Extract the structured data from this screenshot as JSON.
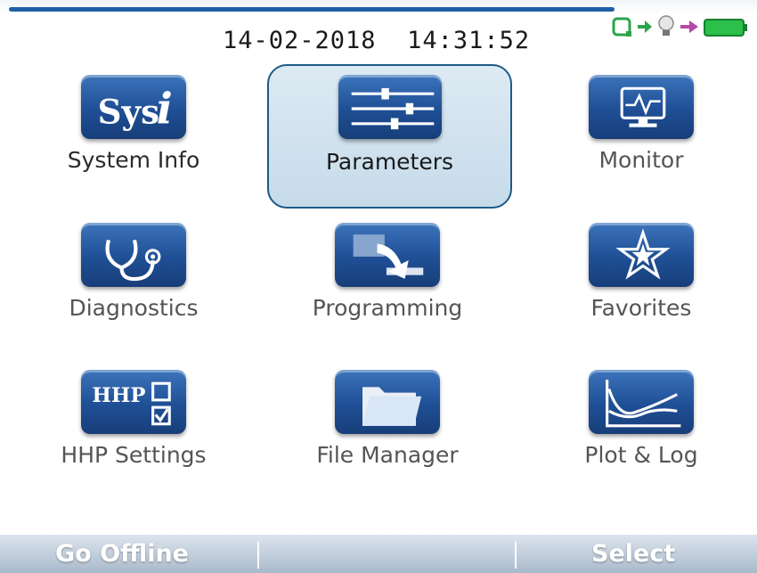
{
  "header": {
    "date": "14-02-2018",
    "time": "14:31:52"
  },
  "status_icons": [
    "connection-icon",
    "arrow-icon",
    "bulb-icon",
    "arrow-icon",
    "battery-icon"
  ],
  "colors": {
    "accent": "#1f5fa8",
    "selected_bg": "#cfe0ed",
    "icon_blue": "#2457a0",
    "softkey_bar": "#bccada"
  },
  "menu": {
    "selected": "Parameters",
    "items": [
      {
        "label": "System Info",
        "icon": "system-info-icon"
      },
      {
        "label": "Parameters",
        "icon": "parameters-sliders-icon"
      },
      {
        "label": "Monitor",
        "icon": "monitor-icon"
      },
      {
        "label": "Diagnostics",
        "icon": "stethoscope-icon"
      },
      {
        "label": "Programming",
        "icon": "programming-icon"
      },
      {
        "label": "Favorites",
        "icon": "favorites-star-icon"
      },
      {
        "label": "HHP Settings",
        "icon": "hhp-settings-icon"
      },
      {
        "label": "File Manager",
        "icon": "folder-icon"
      },
      {
        "label": "Plot & Log",
        "icon": "plot-icon"
      }
    ]
  },
  "softkeys": {
    "left": "Go Offline",
    "middle": "",
    "right": "Select"
  }
}
